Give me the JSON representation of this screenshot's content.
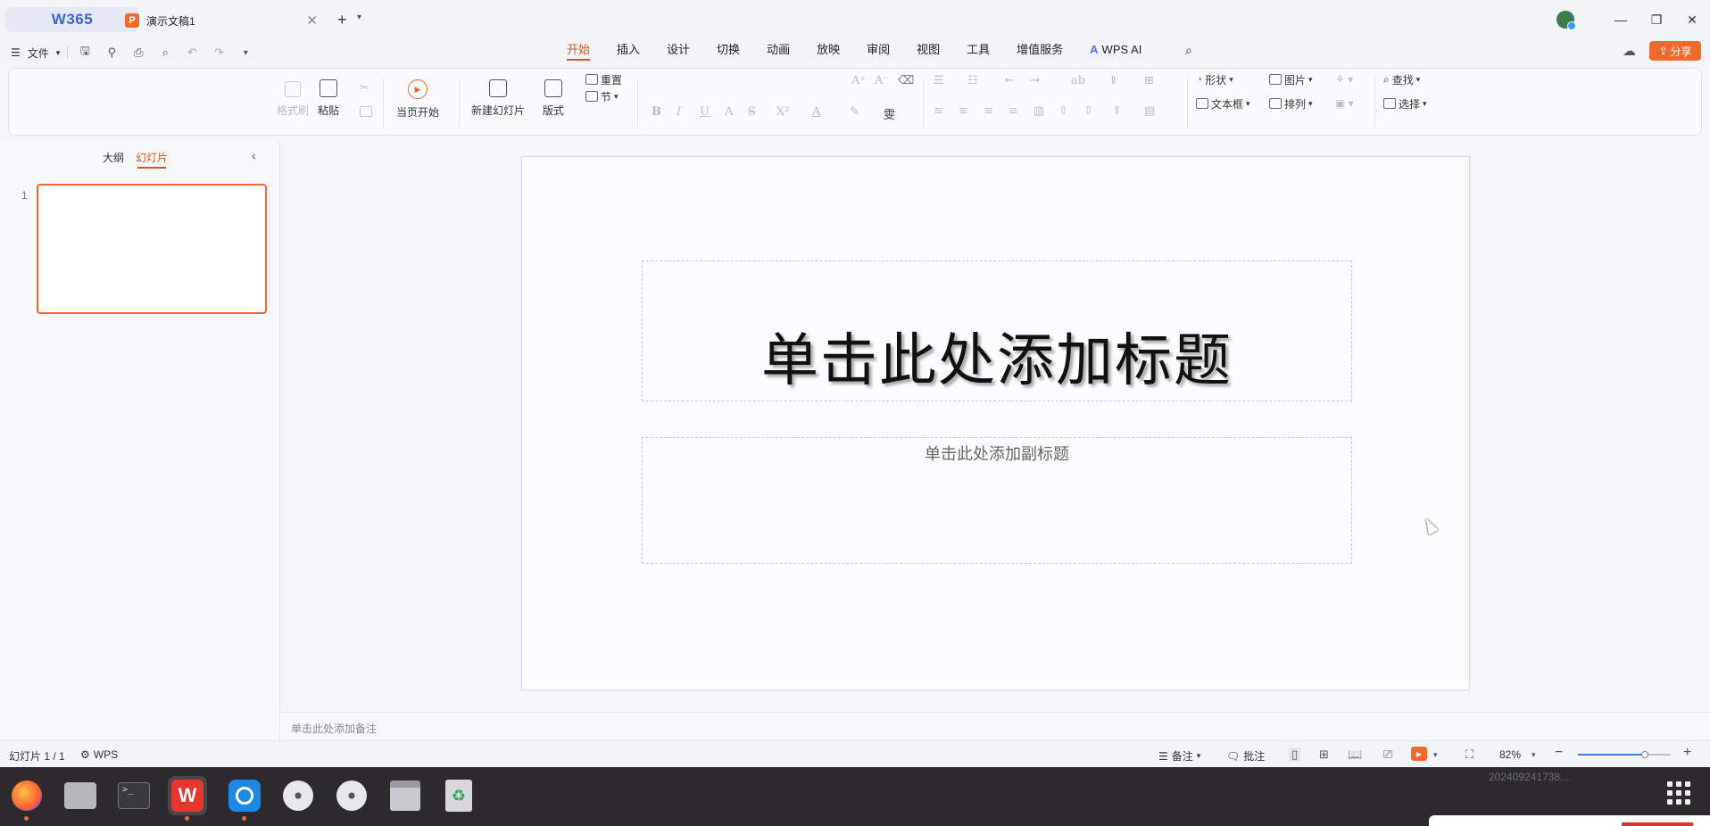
{
  "titlebar": {
    "home_tab": "W365",
    "doc_tab_title": "演示文稿1",
    "new_tab": "+"
  },
  "menu": {
    "file": "文件",
    "tabs": [
      "开始",
      "插入",
      "设计",
      "切换",
      "动画",
      "放映",
      "审阅",
      "视图",
      "工具",
      "增值服务",
      "WPS AI"
    ],
    "active_tab": "开始",
    "share": "分享"
  },
  "ribbon": {
    "format_painter": "格式刷",
    "paste": "粘贴",
    "start_from_first": "当页开始",
    "new_slide": "新建幻灯片",
    "layout": "版式",
    "reset": "重置",
    "section": "节",
    "shape": "形状",
    "picture": "图片",
    "textbox": "文本框",
    "arrange": "排列",
    "find": "查找",
    "select": "选择"
  },
  "left_panel": {
    "tab_outline": "大纲",
    "tab_slides": "幻灯片",
    "slide_number": "1"
  },
  "slide": {
    "title_placeholder": "单击此处添加标题",
    "subtitle_placeholder": "单击此处添加副标题"
  },
  "notes": {
    "placeholder": "单击此处添加备注"
  },
  "status": {
    "slide_count": "幻灯片 1 / 1",
    "theme": "WPS",
    "notes_btn": "备注",
    "comments_btn": "批注",
    "zoom": "82%",
    "zoom_fraction": 0.72
  },
  "taskbar": {
    "timestamp": "202409241738..."
  },
  "colors": {
    "accent": "#d9541c",
    "brand_orange": "#f06a2b",
    "taskbar": "#2c2a2d"
  }
}
